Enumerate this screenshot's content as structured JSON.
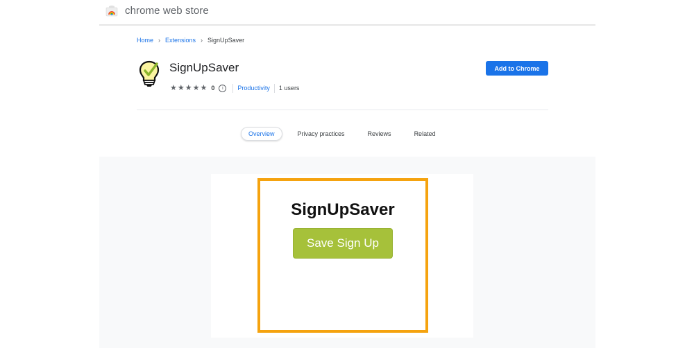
{
  "header": {
    "store_title": "chrome web store",
    "logo_icon": "chrome-web-store-icon"
  },
  "breadcrumb": {
    "items": [
      "Home",
      "Extensions",
      "SignUpSaver"
    ],
    "separator": "›"
  },
  "extension": {
    "name": "SignUpSaver",
    "icon": "lightbulb-check-icon",
    "rating_stars": 0,
    "rating_count": "0",
    "category": "Productivity",
    "users": "1 users",
    "add_button_label": "Add to Chrome"
  },
  "tabs": [
    {
      "label": "Overview",
      "active": true
    },
    {
      "label": "Privacy practices",
      "active": false
    },
    {
      "label": "Reviews",
      "active": false
    },
    {
      "label": "Related",
      "active": false
    }
  ],
  "screenshot": {
    "title": "SignUpSaver",
    "button_label": "Save Sign Up"
  },
  "colors": {
    "accent": "#1a73e8",
    "frame": "#f5a30f",
    "save_button": "#a6c13a"
  }
}
